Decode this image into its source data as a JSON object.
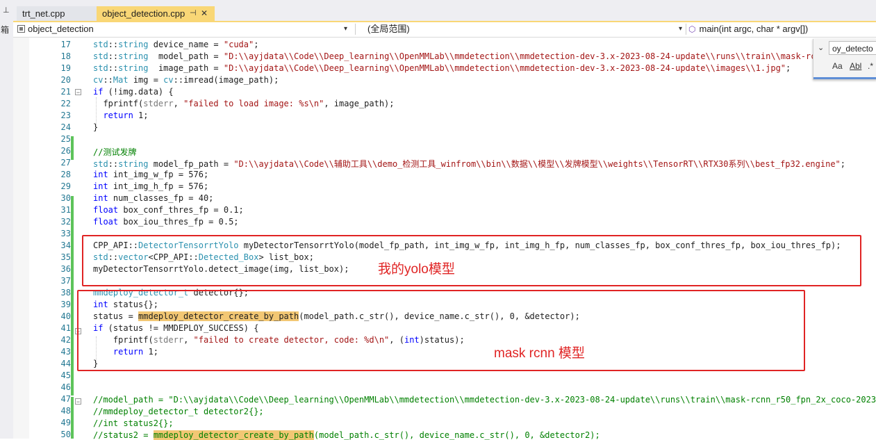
{
  "left_strip": {
    "pin": "⊥",
    "label": "箱"
  },
  "tabs": [
    {
      "label": "trt_net.cpp",
      "active": false
    },
    {
      "label": "object_detection.cpp",
      "active": true,
      "pin": "⊣",
      "close": "✕"
    }
  ],
  "nav": {
    "project": "object_detection",
    "scope": "(全局范围)",
    "member": "main(int argc, char * argv[])",
    "dropdown_arrow": "▾"
  },
  "find_widget": {
    "chevron": "⌄",
    "query": "oy_detecto",
    "match_case": "Aa",
    "whole_word": "Abl",
    "regex": ".*"
  },
  "code": {
    "line_numbers": [
      "17",
      "18",
      "19",
      "20",
      "21",
      "22",
      "23",
      "24",
      "25",
      "26",
      "27",
      "28",
      "29",
      "30",
      "31",
      "32",
      "33",
      "34",
      "35",
      "36",
      "37",
      "38",
      "39",
      "40",
      "41",
      "42",
      "43",
      "44",
      "45",
      "46",
      "47",
      "48",
      "49",
      "50"
    ]
  },
  "annotations": {
    "yolo": "我的yolo模型",
    "mask": "mask rcnn 模型"
  },
  "colors": {
    "keyword": "#0000ff",
    "type": "#2b91af",
    "string": "#a31515",
    "comment": "#008000",
    "highlight": "#f2c774",
    "annotation_red": "#e02424",
    "active_tab": "#f9d776",
    "change_bar": "#5dc35a"
  }
}
